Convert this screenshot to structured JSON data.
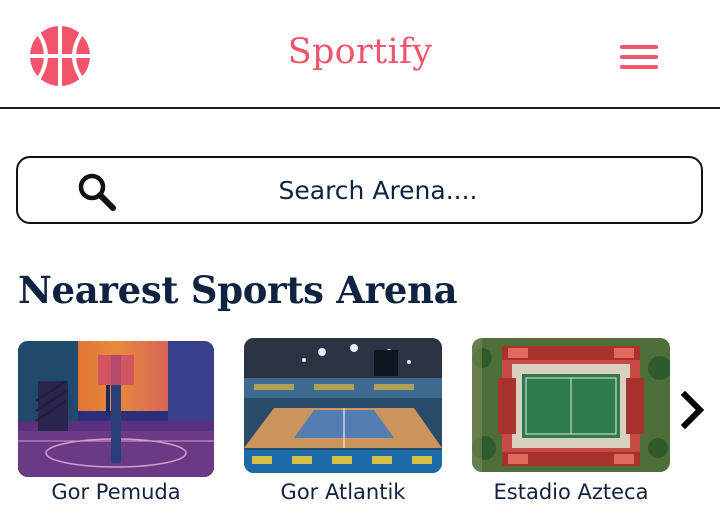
{
  "header": {
    "app_title": "Sportify",
    "logo_icon": "basketball-icon",
    "menu_icon": "hamburger-menu-icon"
  },
  "search": {
    "placeholder": "Search Arena....",
    "icon": "search-icon"
  },
  "section": {
    "title": "Nearest Sports Arena"
  },
  "arenas": [
    {
      "name": "Gor Pemuda"
    },
    {
      "name": "Gor Atlantik"
    },
    {
      "name": "Estadio Azteca"
    }
  ],
  "carousel": {
    "next_icon": "chevron-right-icon"
  },
  "colors": {
    "accent": "#f2546c",
    "text": "#0f2340"
  }
}
